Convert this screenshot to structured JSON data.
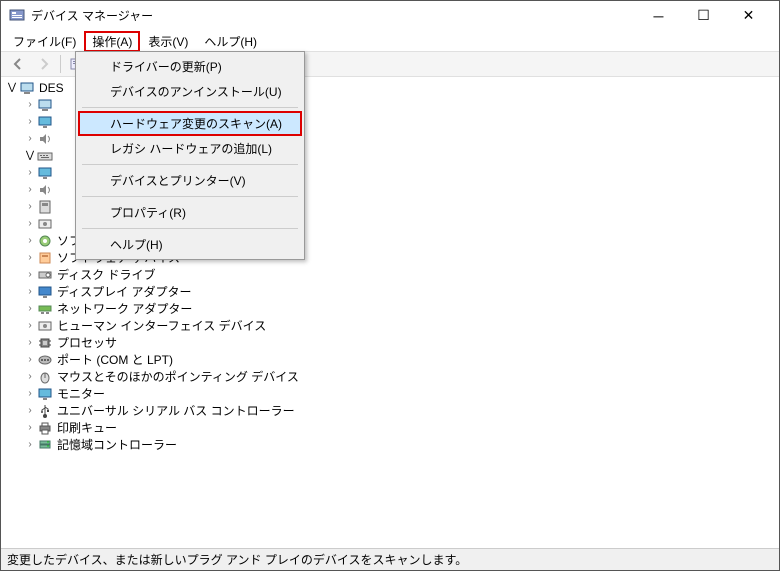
{
  "window": {
    "title": "デバイス マネージャー"
  },
  "menubar": {
    "items": [
      "ファイル(F)",
      "操作(A)",
      "表示(V)",
      "ヘルプ(H)"
    ]
  },
  "dropdown": {
    "items": [
      {
        "label": "ドライバーの更新(P)"
      },
      {
        "label": "デバイスのアンインストール(U)"
      },
      {
        "sep": true
      },
      {
        "label": "ハードウェア変更のスキャン(A)",
        "highlighted": true
      },
      {
        "label": "レガシ ハードウェアの追加(L)"
      },
      {
        "sep": true
      },
      {
        "label": "デバイスとプリンター(V)"
      },
      {
        "sep": true
      },
      {
        "label": "プロパティ(R)"
      },
      {
        "sep": true
      },
      {
        "label": "ヘルプ(H)"
      }
    ]
  },
  "tree": {
    "root": "DES",
    "items": [
      {
        "icon": "computer",
        "label": "",
        "truncated": true
      },
      {
        "icon": "monitor",
        "label": ""
      },
      {
        "icon": "audio",
        "label": ""
      },
      {
        "icon": "keyboard",
        "label": "",
        "expanded": true
      },
      {
        "icon": "monitor",
        "label": ""
      },
      {
        "icon": "audio",
        "label": ""
      },
      {
        "icon": "system",
        "label": ""
      },
      {
        "icon": "hid",
        "label": ""
      },
      {
        "icon": "component",
        "label": "ソフトウェア コンポーネント"
      },
      {
        "icon": "software",
        "label": "ソフトウェア デバイス"
      },
      {
        "icon": "disk",
        "label": "ディスク ドライブ"
      },
      {
        "icon": "display",
        "label": "ディスプレイ アダプター"
      },
      {
        "icon": "network",
        "label": "ネットワーク アダプター"
      },
      {
        "icon": "hid",
        "label": "ヒューマン インターフェイス デバイス"
      },
      {
        "icon": "cpu",
        "label": "プロセッサ"
      },
      {
        "icon": "port",
        "label": "ポート (COM と LPT)"
      },
      {
        "icon": "mouse",
        "label": "マウスとそのほかのポインティング デバイス"
      },
      {
        "icon": "monitor",
        "label": "モニター"
      },
      {
        "icon": "usb",
        "label": "ユニバーサル シリアル バス コントローラー"
      },
      {
        "icon": "printer",
        "label": "印刷キュー"
      },
      {
        "icon": "storage",
        "label": "記憶域コントローラー"
      }
    ]
  },
  "statusbar": {
    "text": "変更したデバイス、または新しいプラグ アンド プレイのデバイスをスキャンします。"
  }
}
